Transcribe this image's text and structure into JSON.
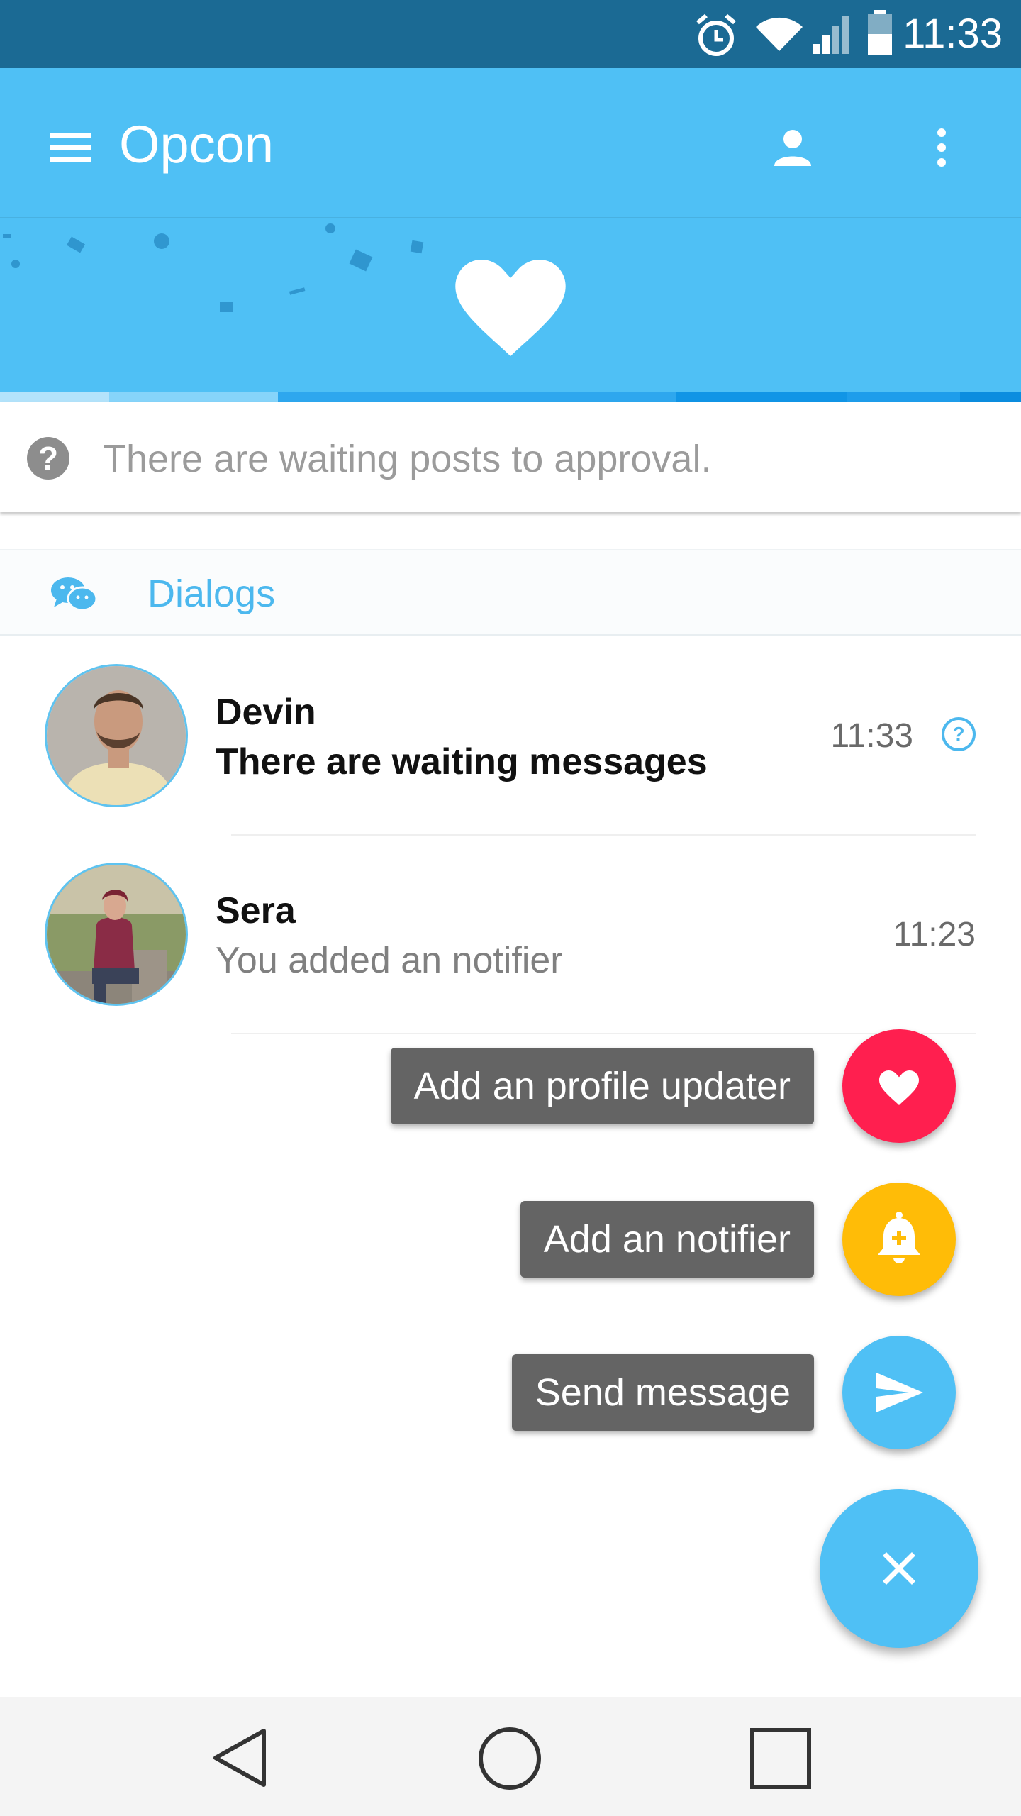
{
  "status_bar": {
    "time": "11:33",
    "icons": [
      "alarm-icon",
      "wifi-icon",
      "signal-icon",
      "battery-icon"
    ]
  },
  "app_bar": {
    "title": "Opcon",
    "icons": [
      "menu-icon",
      "profile-icon",
      "more-vert-icon"
    ]
  },
  "banner": {
    "icon": "heart-icon"
  },
  "notice": {
    "icon": "help-icon",
    "text": "There are waiting posts to approval."
  },
  "dialogs": {
    "icon": "chat-bubbles-icon",
    "title": "Dialogs",
    "items": [
      {
        "name": "Devin",
        "message": "There are waiting messages",
        "time": "11:33",
        "unread": true,
        "status_icon": "help-icon"
      },
      {
        "name": "Sera",
        "message": "You added an notifier",
        "time": "11:23",
        "unread": false
      }
    ]
  },
  "fab_menu": {
    "items": [
      {
        "label": "Add an profile updater",
        "icon": "heart-icon",
        "color": "#ff1f4f"
      },
      {
        "label": "Add an notifier",
        "icon": "bell-plus-icon",
        "color": "#ffbc07"
      },
      {
        "label": "Send message",
        "icon": "send-icon",
        "color": "#4fc0f5"
      }
    ],
    "main_icon": "close-icon",
    "main_color": "#4fc0f5"
  },
  "nav_bar": {
    "icons": [
      "back-icon",
      "home-icon",
      "recents-icon"
    ]
  },
  "colors": {
    "status_bar": "#1b6a94",
    "primary": "#4fc0f5",
    "accent_text": "#4cb8ee"
  }
}
